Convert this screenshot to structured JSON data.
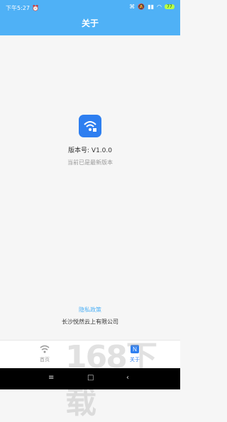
{
  "status_bar": {
    "time": "下午5:27",
    "battery": "77",
    "colors": {
      "text": "#ffffff",
      "battery": "#b6ff4a"
    }
  },
  "header": {
    "title": "关于"
  },
  "app": {
    "icon": "wifi-lock-icon",
    "version_text": "版本号: V1.0.0",
    "latest_text": "当前已是最新版本"
  },
  "footer": {
    "privacy_label": "隐私政策",
    "company_name": "长沙悦然云上有限公司"
  },
  "tabs": [
    {
      "label": "首页",
      "icon": "wifi-tab-icon",
      "active": false
    },
    {
      "label": "关于",
      "icon": "about-tab-icon",
      "active": true
    }
  ],
  "watermark_text": "168下载",
  "colors": {
    "primary": "#4fb1f6",
    "icon_bg": "#2e7ff0",
    "text": "#333333",
    "muted": "#999999",
    "background": "#f6f6f6"
  }
}
